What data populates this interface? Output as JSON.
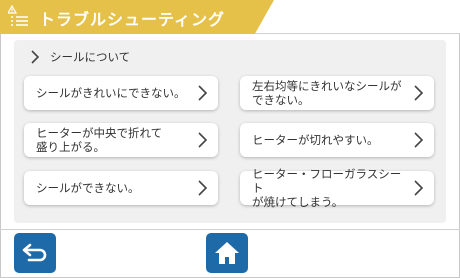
{
  "header": {
    "title": "トラブルシューティング",
    "icon": "warning-checklist-icon",
    "color": "#e6c14a"
  },
  "breadcrumb": {
    "label": "シールについて"
  },
  "issues": [
    {
      "label": "シールがきれいにできない。"
    },
    {
      "label": "左右均等にきれいなシールが\nできない。"
    },
    {
      "label": "ヒーターが中央で折れて\n盛り上がる。"
    },
    {
      "label": "ヒーターが切れやすい。"
    },
    {
      "label": "シールができない。"
    },
    {
      "label": "ヒーター・フローガラスシート\nが焼けてしまう。"
    }
  ],
  "footer": {
    "back_icon": "back-arrow-icon",
    "home_icon": "home-icon",
    "button_color": "#1e6aa8"
  }
}
